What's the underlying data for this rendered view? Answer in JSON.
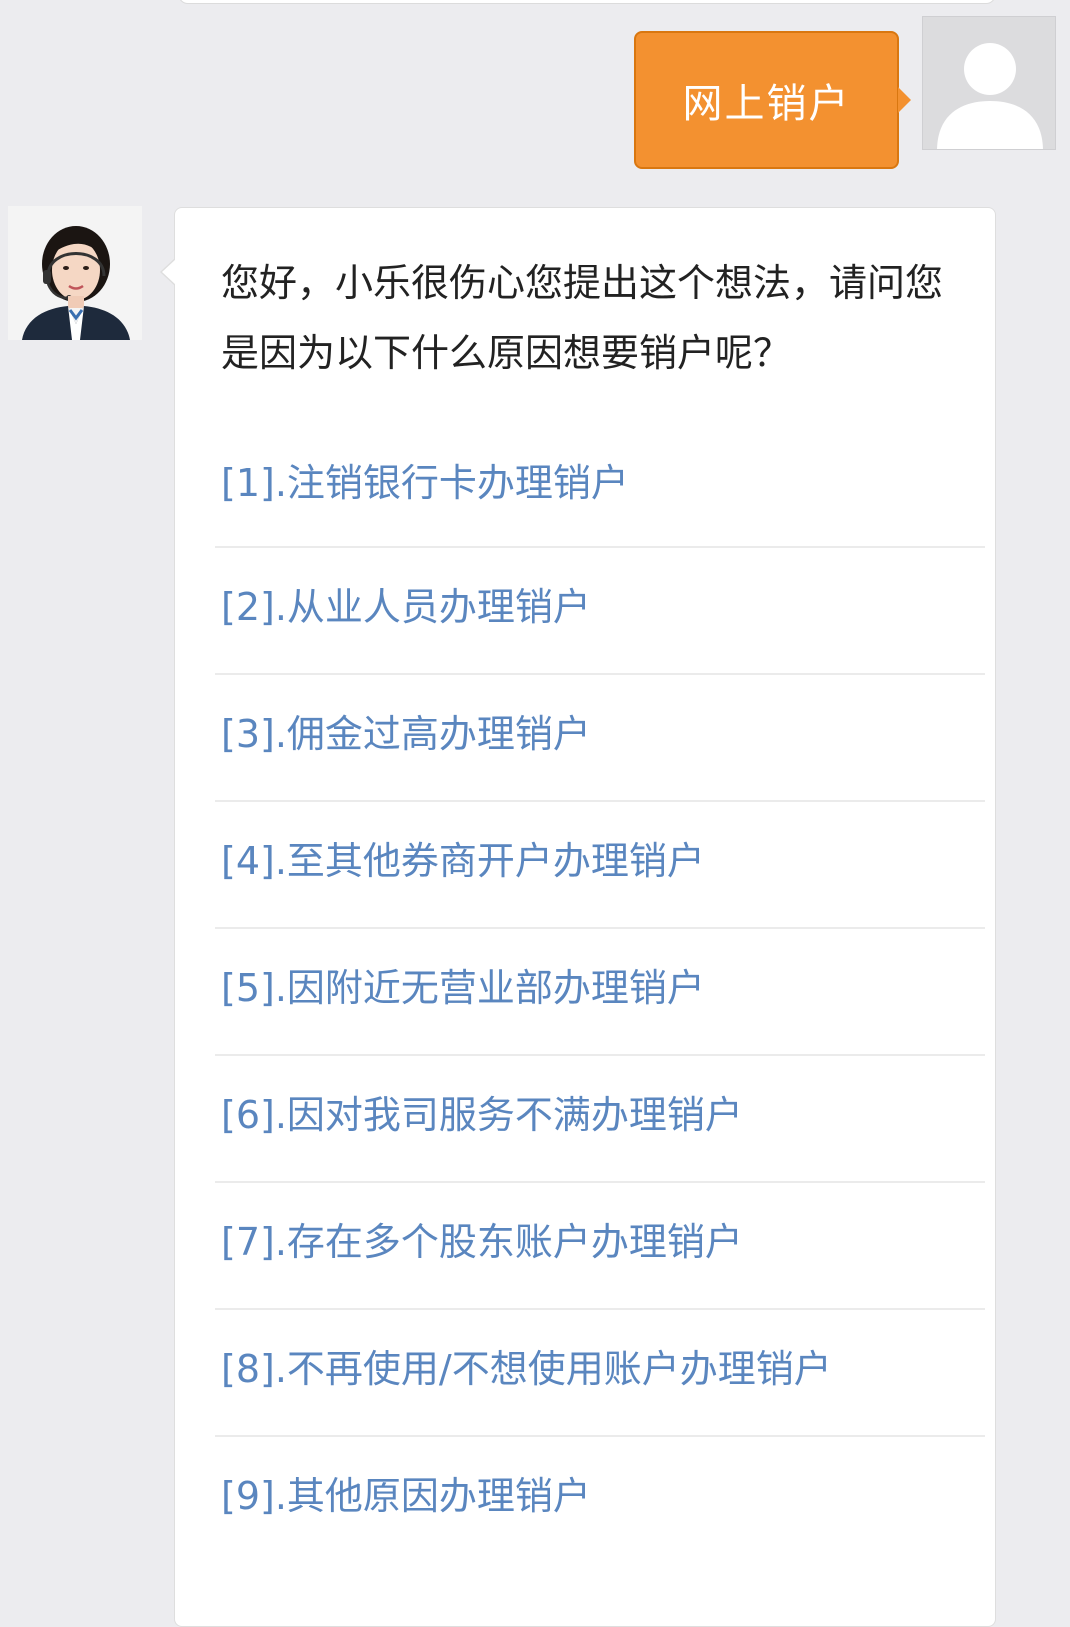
{
  "user_message": {
    "text": "网上销户",
    "bubble_color": "#f39130",
    "avatar_icon": "default-user-avatar"
  },
  "agent_message": {
    "avatar_icon": "customer-service-agent-avatar",
    "greeting": "您好，小乐很伤心您提出这个想法，请问您是因为以下什么原因想要销户呢？",
    "link_color": "#5a86bf",
    "options": [
      {
        "label": "[1].注销银行卡办理销户"
      },
      {
        "label": "[2].从业人员办理销户"
      },
      {
        "label": "[3].佣金过高办理销户"
      },
      {
        "label": "[4].至其他券商开户办理销户"
      },
      {
        "label": "[5].因附近无营业部办理销户"
      },
      {
        "label": "[6].因对我司服务不满办理销户"
      },
      {
        "label": "[7].存在多个股东账户办理销户"
      },
      {
        "label": "[8].不再使用/不想使用账户办理销户"
      },
      {
        "label": "[9].其他原因办理销户"
      }
    ]
  }
}
